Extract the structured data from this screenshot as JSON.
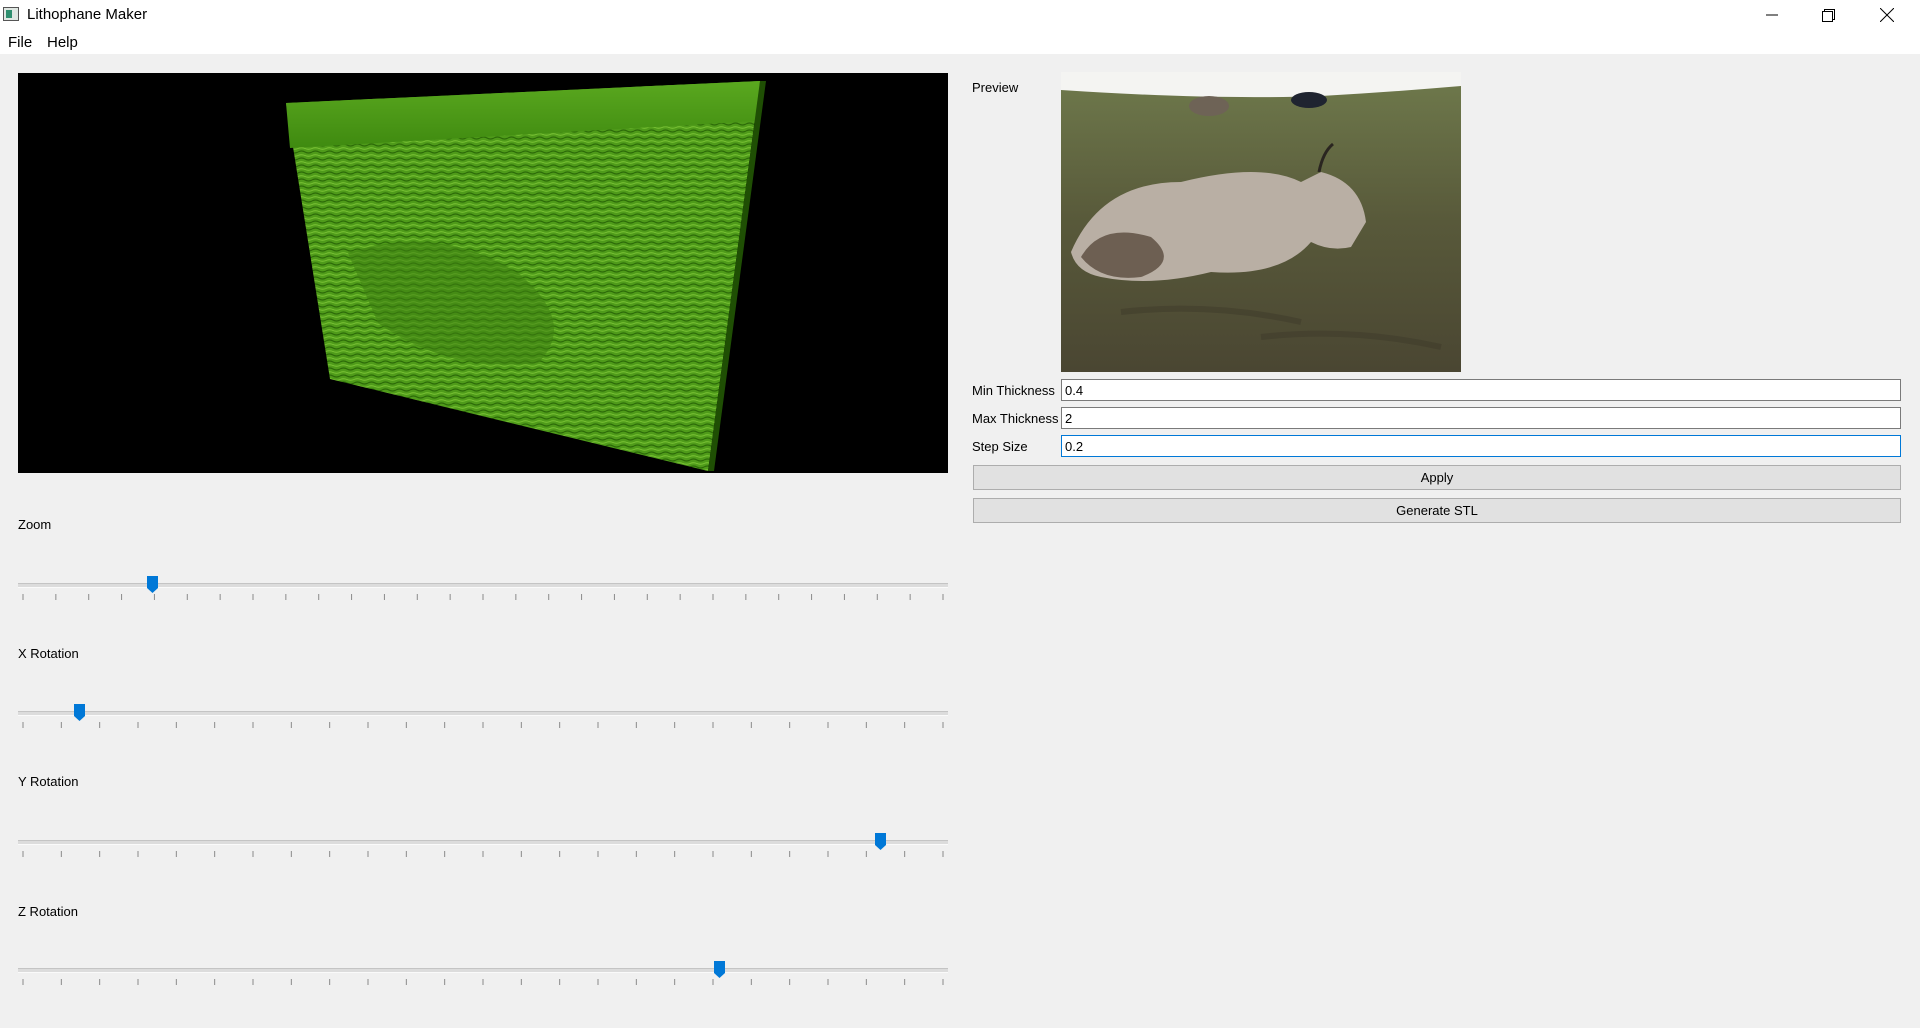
{
  "window": {
    "title": "Lithophane Maker"
  },
  "menu": {
    "items": [
      "File",
      "Help"
    ]
  },
  "sliders": [
    {
      "label": "Zoom",
      "value_fraction": 0.145
    },
    {
      "label": "X Rotation",
      "value_fraction": 0.066
    },
    {
      "label": "Y Rotation",
      "value_fraction": 0.927
    },
    {
      "label": "Z Rotation",
      "value_fraction": 0.754
    }
  ],
  "preview": {
    "label": "Preview"
  },
  "settings": {
    "min_thickness": {
      "label": "Min Thickness",
      "value": "0.4"
    },
    "max_thickness": {
      "label": "Max Thickness",
      "value": "2"
    },
    "step_size": {
      "label": "Step Size",
      "value": "0.2"
    }
  },
  "buttons": {
    "apply": "Apply",
    "generate": "Generate STL"
  },
  "colors": {
    "accent": "#0078d7",
    "mesh": "#4f9b1a",
    "viewport_bg": "#000000"
  }
}
